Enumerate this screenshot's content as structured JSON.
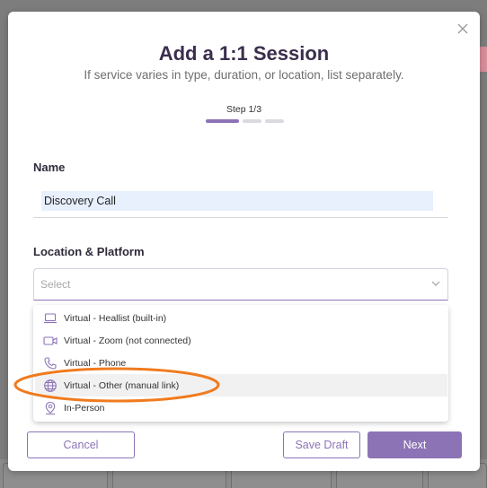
{
  "modal": {
    "title": "Add a 1:1 Session",
    "subtitle": "If service varies in type, duration, or location, list separately.",
    "close_icon": "close-icon",
    "step": {
      "label": "Step 1/3",
      "current": 1,
      "total": 3
    }
  },
  "name_field": {
    "label": "Name",
    "value": "Discovery Call"
  },
  "location_field": {
    "label": "Location & Platform",
    "placeholder": "Select",
    "chevron_icon": "chevron-down-icon"
  },
  "dropdown": {
    "options": [
      {
        "label": "Virtual - Heallist (built-in)",
        "icon": "laptop-icon"
      },
      {
        "label": "Virtual - Zoom (not connected)",
        "icon": "video-camera-icon"
      },
      {
        "label": "Virtual - Phone",
        "icon": "phone-icon"
      },
      {
        "label": "Virtual - Other (manual link)",
        "icon": "globe-icon",
        "highlighted": true
      },
      {
        "label": "In-Person",
        "icon": "location-pin-icon"
      }
    ]
  },
  "buttons": {
    "cancel": "Cancel",
    "save_draft": "Save Draft",
    "next": "Next"
  },
  "colors": {
    "accent": "#8c73b6",
    "title": "#3a2e4d",
    "annotation": "#f07b1f",
    "input_bg": "#e8f0fe"
  }
}
